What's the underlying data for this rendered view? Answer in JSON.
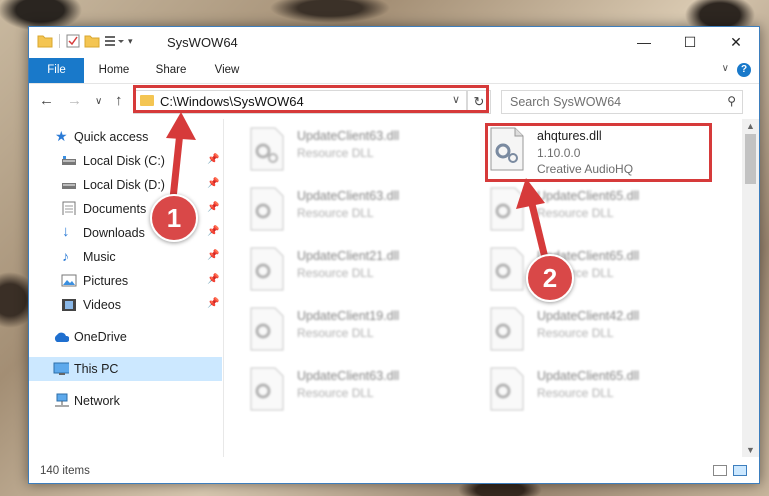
{
  "window": {
    "title": "SysWOW64"
  },
  "ribbon": {
    "tabs": [
      "File",
      "Home",
      "Share",
      "View"
    ]
  },
  "address_bar": {
    "path": "C:\\Windows\\SysWOW64"
  },
  "search": {
    "placeholder": "Search SysWOW64"
  },
  "sidebar": {
    "items": [
      {
        "label": "Quick access",
        "icon": "star-icon"
      },
      {
        "label": "Local Disk (C:)",
        "icon": "drive-icon",
        "pinned": true
      },
      {
        "label": "Local Disk (D:)",
        "icon": "drive-icon",
        "pinned": true
      },
      {
        "label": "Documents",
        "icon": "documents-icon",
        "pinned": true
      },
      {
        "label": "Downloads",
        "icon": "download-icon",
        "pinned": true
      },
      {
        "label": "Music",
        "icon": "music-icon",
        "pinned": true
      },
      {
        "label": "Pictures",
        "icon": "pictures-icon",
        "pinned": true
      },
      {
        "label": "Videos",
        "icon": "videos-icon",
        "pinned": true
      },
      {
        "label": "OneDrive",
        "icon": "cloud-icon"
      },
      {
        "label": "This PC",
        "icon": "computer-icon",
        "selected": true
      },
      {
        "label": "Network",
        "icon": "network-icon"
      }
    ]
  },
  "files": [
    {
      "name": "UpdateClient63.dll",
      "type": "Resource DLL",
      "blurred": true
    },
    {
      "name": "ahqtures.dll",
      "version": "1.10.0.0",
      "company": "Creative AudioHQ",
      "blurred": false
    },
    {
      "name": "UpdateClient63.dll",
      "type": "Resource DLL",
      "blurred": true
    },
    {
      "name": "UpdateClient65.dll",
      "type": "Resource DLL",
      "blurred": true
    },
    {
      "name": "UpdateClient21.dll",
      "type": "Resource DLL",
      "blurred": true
    },
    {
      "name": "UpdateClient65.dll",
      "type": "Resource DLL",
      "blurred": true
    },
    {
      "name": "UpdateClient19.dll",
      "type": "Resource DLL",
      "blurred": true
    },
    {
      "name": "UpdateClient42.dll",
      "type": "Resource DLL",
      "blurred": true
    },
    {
      "name": "UpdateClient63.dll",
      "type": "Resource DLL",
      "blurred": true
    },
    {
      "name": "UpdateClient65.dll",
      "type": "Resource DLL",
      "blurred": true
    }
  ],
  "status": {
    "item_count": "140 items"
  },
  "annotations": {
    "step1": "1",
    "step2": "2",
    "color": "#d63a3a"
  }
}
